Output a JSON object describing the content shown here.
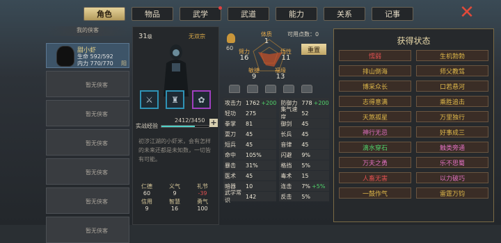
{
  "tabs": [
    {
      "label": "角色",
      "active": true
    },
    {
      "label": "物品"
    },
    {
      "label": "武学",
      "dot": true
    },
    {
      "label": "武道"
    },
    {
      "label": "能力"
    },
    {
      "label": "关系"
    },
    {
      "label": "记事"
    }
  ],
  "close_icon": "close-icon",
  "roster": {
    "header": "我的侠客",
    "hero": {
      "name": "甜小虾",
      "hp": "生命 592/592",
      "mp": "内力 770/770",
      "tag": "阳"
    },
    "empty_label": "暂无侠客",
    "empty_count": 6
  },
  "character": {
    "level": "31",
    "level_unit": "级",
    "sect": "无双宗",
    "exp_label": "实战经验",
    "exp_text": "2412/3450",
    "exp_ratio": 0.699,
    "desc": "初涉江湖的小虾米，会有怎样的未来还都是未知数，一切皆有可能。",
    "virtues": [
      {
        "k": "仁德",
        "v": "60"
      },
      {
        "k": "义气",
        "v": "9"
      },
      {
        "k": "礼节",
        "v": "-39",
        "neg": true
      },
      {
        "k": "信用",
        "v": "9"
      },
      {
        "k": "智慧",
        "v": "16"
      },
      {
        "k": "勇气",
        "v": "100"
      }
    ]
  },
  "attributes": {
    "free_label": "可用点数：",
    "free": "0",
    "reset": "重置",
    "potential": "60",
    "items": [
      {
        "k": "体质",
        "v": "1"
      },
      {
        "k": "臂力",
        "v": "16"
      },
      {
        "k": "悟性",
        "v": "11"
      },
      {
        "k": "敏捷",
        "v": "9"
      },
      {
        "k": "福缘",
        "v": "13"
      }
    ]
  },
  "stats": [
    {
      "k": "攻击力",
      "v": "1762",
      "b": "+200"
    },
    {
      "k": "防御力",
      "v": "778",
      "b": "+200"
    },
    {
      "k": "轻功",
      "v": "275"
    },
    {
      "k": "集气速度",
      "v": "52"
    },
    {
      "k": "拳掌",
      "v": "81"
    },
    {
      "k": "御剑",
      "v": "45"
    },
    {
      "k": "耍刀",
      "v": "45"
    },
    {
      "k": "长兵",
      "v": "45"
    },
    {
      "k": "短兵",
      "v": "45"
    },
    {
      "k": "音律",
      "v": "45"
    },
    {
      "k": "命中",
      "v": "105%"
    },
    {
      "k": "闪避",
      "v": "9%"
    },
    {
      "k": "暴击",
      "v": "31%"
    },
    {
      "k": "格挡",
      "v": "5%"
    },
    {
      "k": "医术",
      "v": "45"
    },
    {
      "k": "毒术",
      "v": "15"
    },
    {
      "k": "暗器",
      "v": "10"
    },
    {
      "k": "连击",
      "v": "7%",
      "b": "+5%"
    },
    {
      "k": "武学常识",
      "v": "142"
    },
    {
      "k": "反击",
      "v": "5%"
    }
  ],
  "states_panel": {
    "title": "获得状态",
    "items": [
      {
        "t": "懦弱",
        "c": "red"
      },
      {
        "t": "生机勃勃",
        "c": "yellow"
      },
      {
        "t": "排山倒海",
        "c": "yellow"
      },
      {
        "t": "师父教驾",
        "c": "yellow"
      },
      {
        "t": "博采众长",
        "c": "yellow"
      },
      {
        "t": "口若悬河",
        "c": "yellow"
      },
      {
        "t": "志得意满",
        "c": "yellow"
      },
      {
        "t": "乘胜追击",
        "c": "yellow"
      },
      {
        "t": "天煞孤星",
        "c": "yellow"
      },
      {
        "t": "万里独行",
        "c": "yellow"
      },
      {
        "t": "神行无忌",
        "c": "pink"
      },
      {
        "t": "好事成三",
        "c": "yellow"
      },
      {
        "t": "滴水穿石",
        "c": "green"
      },
      {
        "t": "触类旁通",
        "c": "pink"
      },
      {
        "t": "万夫之勇",
        "c": "pink"
      },
      {
        "t": "乐不思蜀",
        "c": "pink"
      },
      {
        "t": "人畜无害",
        "c": "red"
      },
      {
        "t": "以力破巧",
        "c": "pink"
      },
      {
        "t": "一鼓作气",
        "c": "yellow"
      },
      {
        "t": "雷霆万钧",
        "c": "yellow"
      }
    ]
  }
}
